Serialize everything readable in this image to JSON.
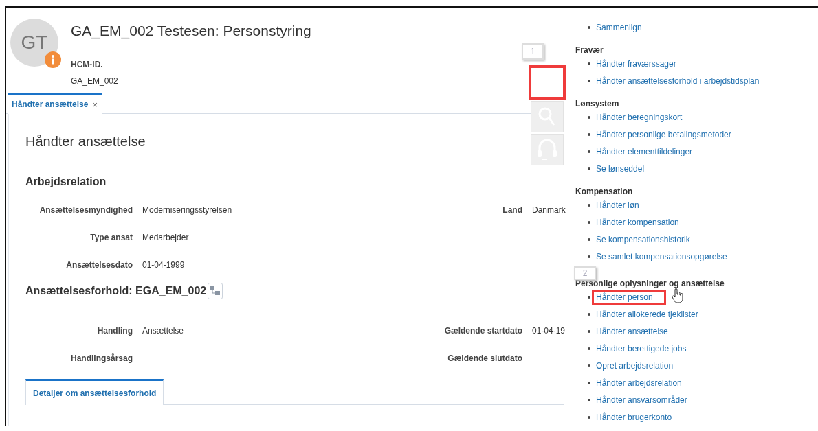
{
  "header": {
    "avatar_initials": "GT",
    "title": "GA_EM_002 Testesen: Personstyring",
    "id_label": "HCM-ID.",
    "id_value": "GA_EM_002"
  },
  "tabs": [
    {
      "label": "Håndter ansættelse",
      "close": "×",
      "selected": true
    }
  ],
  "page_title": "Håndter ansættelse",
  "sections": [
    {
      "title": "Arbejdsrelation",
      "hierarchy_button": false,
      "rows": [
        {
          "left": {
            "label": "Ansættelsesmyndighed",
            "value": "Moderniseringsstyrelsen"
          },
          "right": {
            "label": "Land",
            "value": "Danmark"
          }
        },
        {
          "left": {
            "label": "Type ansat",
            "value": "Medarbejder"
          }
        },
        {
          "left": {
            "label": "Ansættelsesdato",
            "value": "01-04-1999"
          }
        }
      ]
    },
    {
      "title": "Ansættelsesforhold: EGA_EM_002",
      "hierarchy_button": true,
      "rows": [
        {
          "left": {
            "label": "Handling",
            "value": "Ansættelse"
          },
          "right": {
            "label": "Gældende startdato",
            "value": "01-04-19"
          }
        },
        {
          "left": {
            "label": "Handlingsårsag"
          },
          "right": {
            "label": "Gældende slutdato"
          }
        }
      ]
    }
  ],
  "subtabs": [
    {
      "label": "Detaljer om ansættelsesforhold",
      "selected": true
    }
  ],
  "toolbar": [
    {
      "kind": "blank",
      "highlighted": true,
      "callout": "1"
    },
    {
      "kind": "search",
      "highlighted": false
    },
    {
      "kind": "support",
      "highlighted": false
    }
  ],
  "task_panel": {
    "top_items": [
      {
        "label": "Sammenlign",
        "highlighted": false
      }
    ],
    "groups": [
      {
        "title": "Fravær",
        "items": [
          {
            "label": "Håndter fraværssager",
            "highlighted": false
          },
          {
            "label": "Håndter ansættelsesforhold i arbejdstidsplan",
            "highlighted": false
          }
        ]
      },
      {
        "title": "Lønsystem",
        "items": [
          {
            "label": "Håndter beregningskort",
            "highlighted": false
          },
          {
            "label": "Håndter personlige betalingsmetoder",
            "highlighted": false
          },
          {
            "label": "Håndter elementtildelinger",
            "highlighted": false
          },
          {
            "label": "Se lønseddel",
            "highlighted": false
          }
        ]
      },
      {
        "title": "Kompensation",
        "items": [
          {
            "label": "Håndter løn",
            "highlighted": false
          },
          {
            "label": "Håndter kompensation",
            "highlighted": false
          },
          {
            "label": "Se kompensationshistorik",
            "highlighted": false
          },
          {
            "label": "Se samlet kompensationsopgørelse",
            "highlighted": false
          }
        ]
      },
      {
        "title": "Personlige oplysninger og ansættelse",
        "callout": "2",
        "items": [
          {
            "label": "Håndter person",
            "highlighted": true
          },
          {
            "label": "Håndter allokerede tjeklister",
            "highlighted": false
          },
          {
            "label": "Håndter ansættelse",
            "highlighted": false
          },
          {
            "label": "Håndter berettigede jobs",
            "highlighted": false
          },
          {
            "label": "Opret arbejdsrelation",
            "highlighted": false
          },
          {
            "label": "Håndter arbejdsrelation",
            "highlighted": false
          },
          {
            "label": "Håndter ansvarsområder",
            "highlighted": false
          },
          {
            "label": "Håndter brugerkonto",
            "highlighted": false
          }
        ]
      }
    ]
  }
}
